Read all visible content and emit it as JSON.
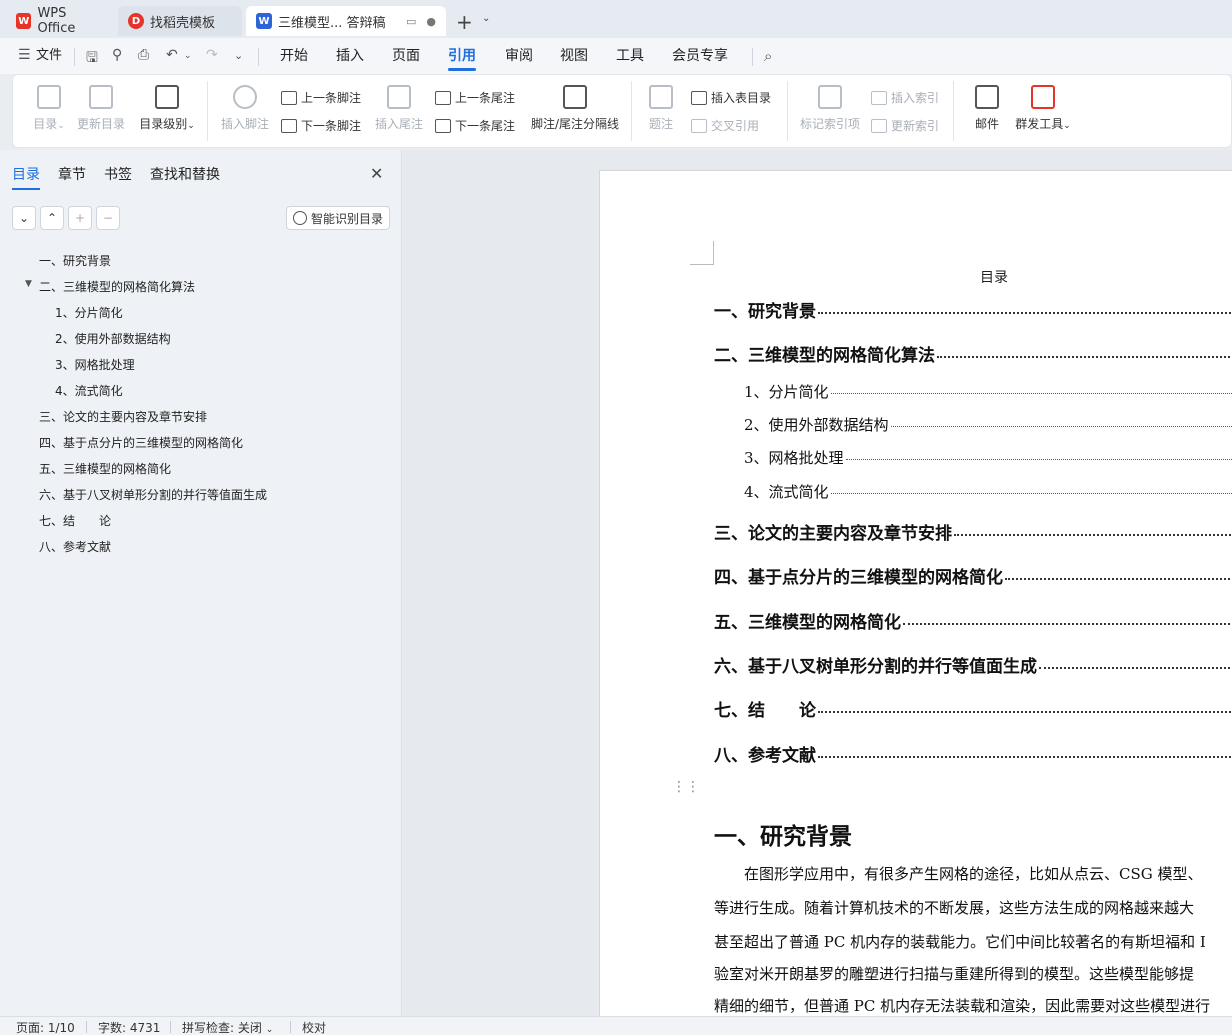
{
  "tabs": {
    "wps": "WPS Office",
    "daoke": "找稻壳模板",
    "doc": "三维模型... 答辩稿"
  },
  "menu": {
    "file": "文件",
    "items": [
      "开始",
      "插入",
      "页面",
      "引用",
      "审阅",
      "视图",
      "工具",
      "会员专享"
    ],
    "active": "引用"
  },
  "ribbon": {
    "toc": "目录",
    "update_toc": "更新目录",
    "toc_level": "目录级别",
    "insert_footnote": "插入脚注",
    "prev_footnote": "上一条脚注",
    "next_footnote": "下一条脚注",
    "insert_endnote": "插入尾注",
    "prev_endnote": "上一条尾注",
    "next_endnote": "下一条尾注",
    "separator": "脚注/尾注分隔线",
    "caption": "题注",
    "insert_table_toc": "插入表目录",
    "cross_ref": "交叉引用",
    "mark_index": "标记索引项",
    "insert_index": "插入索引",
    "update_index": "更新索引",
    "mail": "邮件",
    "mass_tools": "群发工具"
  },
  "left_panel": {
    "tabs": [
      "目录",
      "章节",
      "书签",
      "查找和替换"
    ],
    "smart_button": "智能识别目录",
    "outline": [
      {
        "text": "一、研究背景",
        "level": 1
      },
      {
        "text": "二、三维模型的网格简化算法",
        "level": 1,
        "expanded": true
      },
      {
        "text": "1、分片简化",
        "level": 2
      },
      {
        "text": "2、使用外部数据结构",
        "level": 2
      },
      {
        "text": "3、网格批处理",
        "level": 2
      },
      {
        "text": "4、流式简化",
        "level": 2
      },
      {
        "text": "三、论文的主要内容及章节安排",
        "level": 1
      },
      {
        "text": "四、基于点分片的三维模型的网格简化",
        "level": 1
      },
      {
        "text": "五、三维模型的网格简化",
        "level": 1
      },
      {
        "text": "六、基于八叉树单形分割的并行等值面生成",
        "level": 1
      },
      {
        "text": "七、结　　论",
        "level": 1
      },
      {
        "text": "八、参考文献",
        "level": 1
      }
    ]
  },
  "document": {
    "toc_title": "目录",
    "toc": [
      {
        "text": "一、研究背景",
        "level": 1
      },
      {
        "text": "二、三维模型的网格简化算法",
        "level": 1
      },
      {
        "text": "1、分片简化",
        "level": 2
      },
      {
        "text": "2、使用外部数据结构",
        "level": 2
      },
      {
        "text": "3、网格批处理",
        "level": 2
      },
      {
        "text": "4、流式简化",
        "level": 2
      },
      {
        "text": "三、论文的主要内容及章节安排",
        "level": 1
      },
      {
        "text": "四、基于点分片的三维模型的网格简化",
        "level": 1
      },
      {
        "text": "五、三维模型的网格简化",
        "level": 1
      },
      {
        "text": "六、基于八叉树单形分割的并行等值面生成",
        "level": 1
      },
      {
        "text": "七、结　　论",
        "level": 1
      },
      {
        "text": "八、参考文献",
        "level": 1
      }
    ],
    "heading": "一、研究背景",
    "paragraph_lines": [
      "　　在图形学应用中，有很多产生网格的途径，比如从点云、CSG 模型、",
      "等进行生成。随着计算机技术的不断发展，这些方法生成的网格越来越大",
      "甚至超出了普通 PC 机内存的装载能力。它们中间比较著名的有斯坦福和 I",
      "验室对米开朗基罗的雕塑进行扫描与重建所得到的模型。这些模型能够提",
      "精细的细节，但普通 PC 机内存无法装载和渲染，因此需要对这些模型进行"
    ]
  },
  "status": {
    "page": "页面: 1/10",
    "words": "字数: 4731",
    "spell": "拼写检查: 关闭",
    "proof": "校对"
  },
  "colors": {
    "accent": "#1f6fe0",
    "wps_red": "#e5352b",
    "word_blue": "#2d64d8"
  }
}
